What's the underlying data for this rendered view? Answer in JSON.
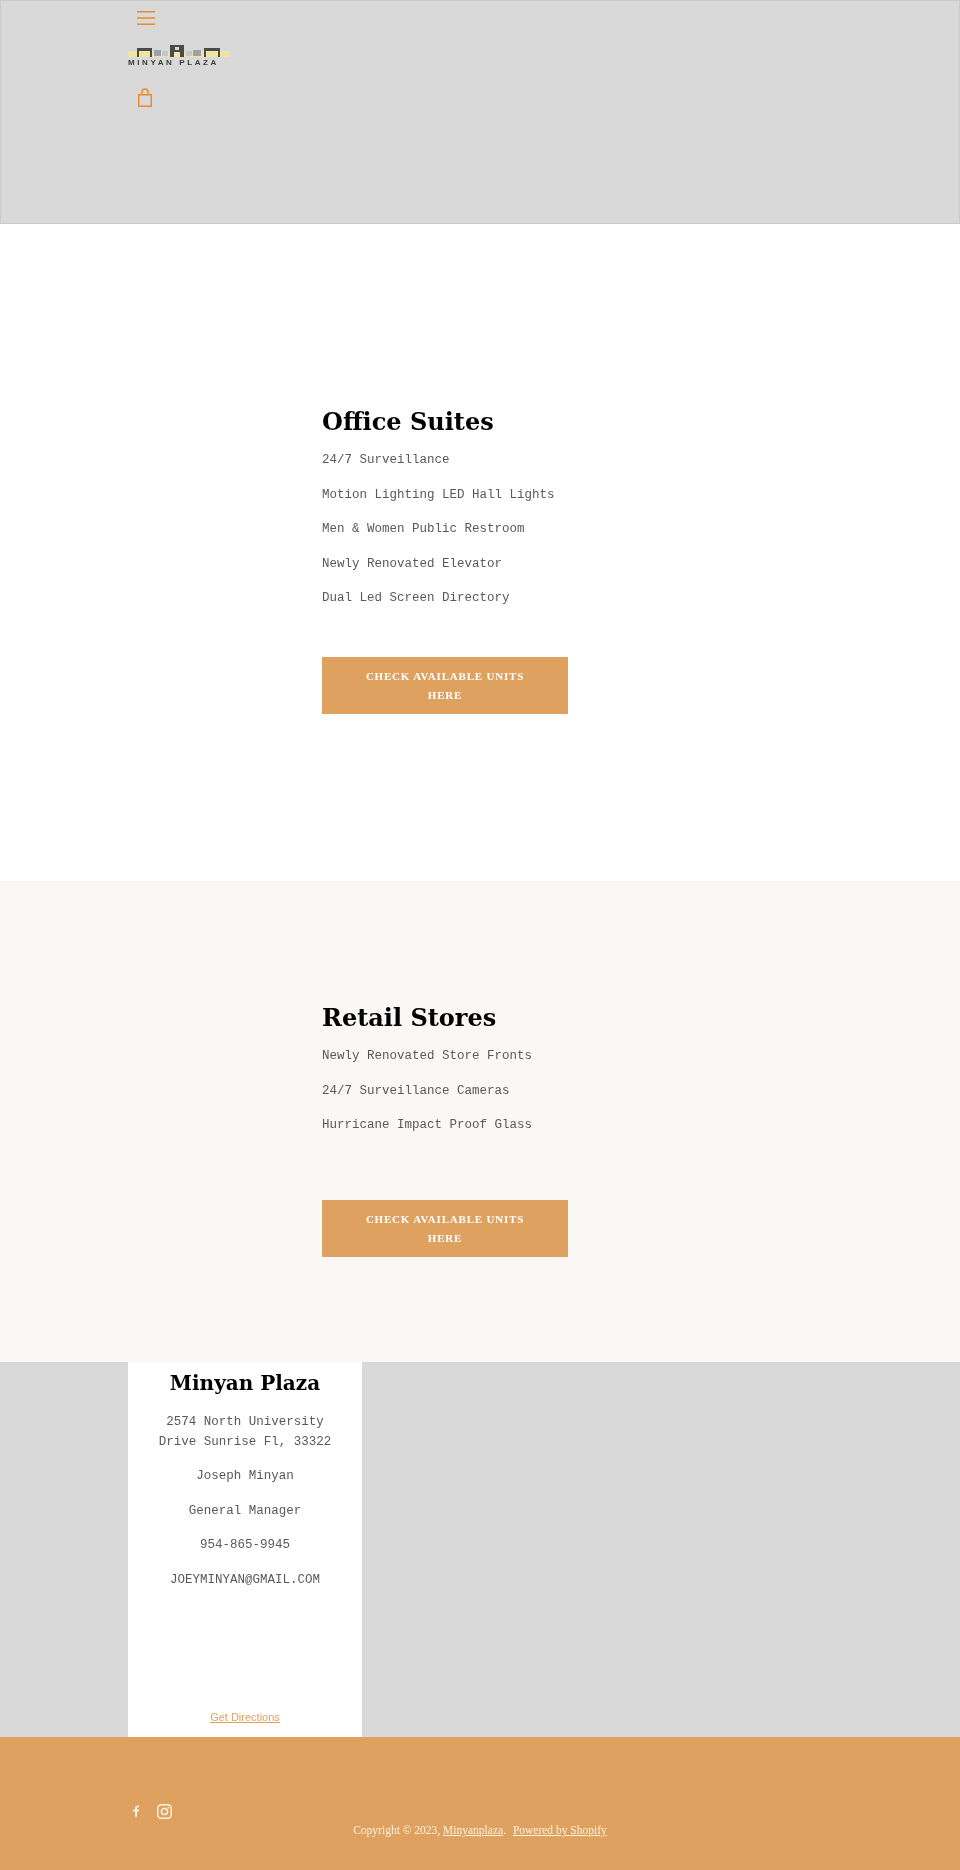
{
  "header": {
    "logo_text": "MINYAN PLAZA"
  },
  "sections": [
    {
      "title": "Office Suites",
      "features": [
        "24/7 Surveillance",
        "Motion Lighting LED Hall Lights",
        "Men & Women Public Restroom",
        "Newly Renovated Elevator",
        "Dual Led Screen Directory"
      ],
      "button": "CHECK AVAILABLE UNITS HERE"
    },
    {
      "title": "Retail Stores",
      "features": [
        "Newly Renovated Store Fronts",
        "24/7 Surveillance Cameras",
        "Hurricane Impact Proof Glass"
      ],
      "button": "CHECK AVAILABLE UNITS HERE"
    }
  ],
  "contact": {
    "title": "Minyan Plaza",
    "address": "2574 North University Drive Sunrise Fl, 33322",
    "lines": [
      "Joseph Minyan",
      "General Manager",
      "954-865-9945",
      "JOEYMINYAN@GMAIL.COM"
    ],
    "link": "Get Directions"
  },
  "footer": {
    "copyright": "Copyright © 2023,",
    "site_link": "Minyanplaza",
    "separator": ".",
    "powered_link": "Powered by Shopify"
  }
}
